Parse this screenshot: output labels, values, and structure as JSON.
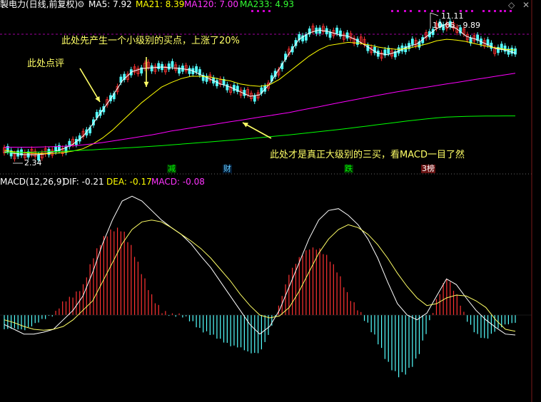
{
  "header": {
    "title": "製电力(日线,前复权)",
    "ma5_label": "MA5: 7.92",
    "ma21_label": "MA21: 8.39",
    "ma120_label": "MA120: 7.00",
    "ma233_label": "MA233: 4.93",
    "settings_icon": "gear-icon",
    "right_icons": [
      "diamond-icon",
      "close-icon"
    ]
  },
  "colors": {
    "up": "#ff3232",
    "down": "#54ffff",
    "ma5": "#ffffff",
    "ma21": "#ffff00",
    "ma120": "#ff00ff",
    "ma233": "#00ff00",
    "annotation": "#ffff66",
    "grid_dash": "#a000a0"
  },
  "annotations": {
    "a1": "此处先产生一个小级别的买点，上涨了20%",
    "a2": "此处点评",
    "a3": "此处才是真正大级别的三买，看MACD一目了然"
  },
  "price_labels": {
    "high": "11.11",
    "range": "10.05 - 9.89",
    "low": "2.34"
  },
  "events": [
    "减",
    "财",
    "跌",
    "3榜"
  ],
  "macd": {
    "title": "MACD(12,26,9)",
    "dif_label": "DIF: -0.21",
    "dea_label": "DEA: -0.17",
    "macd_label": "MACD: -0.08"
  },
  "chart_data": [
    {
      "type": "line",
      "title": "製电力(日线,前复权)",
      "series": [
        {
          "name": "MA5",
          "values": [
            2.6,
            2.5,
            2.42,
            2.4,
            2.45,
            2.6,
            2.8,
            3.1,
            3.6,
            4.4,
            5.3,
            6.2,
            7.2,
            7.8,
            8.0,
            8.05,
            8.1,
            8.05,
            8.0,
            7.9,
            7.6,
            7.3,
            7.0,
            6.8,
            6.5,
            6.2,
            6.3,
            7.0,
            8.0,
            9.0,
            9.9,
            10.3,
            10.5,
            10.4,
            10.2,
            10.1,
            9.8,
            9.4,
            9.0,
            8.9,
            9.1,
            9.4,
            9.6,
            10.1,
            10.6,
            10.9,
            10.6,
            10.1,
            9.9,
            9.6,
            9.3,
            9.2,
            9.0
          ]
        },
        {
          "name": "MA21",
          "values": [
            2.7,
            2.6,
            2.55,
            2.5,
            2.48,
            2.5,
            2.55,
            2.65,
            2.8,
            3.1,
            3.5,
            4.0,
            4.6,
            5.2,
            5.8,
            6.3,
            6.8,
            7.1,
            7.35,
            7.5,
            7.5,
            7.45,
            7.3,
            7.2,
            7.0,
            6.9,
            6.85,
            6.95,
            7.3,
            7.8,
            8.3,
            8.8,
            9.2,
            9.5,
            9.6,
            9.7,
            9.65,
            9.55,
            9.4,
            9.3,
            9.25,
            9.3,
            9.45,
            9.6,
            9.8,
            9.9,
            9.85,
            9.75,
            9.6,
            9.45,
            9.35,
            9.25,
            9.2
          ]
        },
        {
          "name": "MA120",
          "values": [
            2.9,
            2.9,
            2.9,
            2.9,
            2.92,
            2.94,
            2.96,
            3.0,
            3.05,
            3.12,
            3.2,
            3.3,
            3.4,
            3.5,
            3.6,
            3.7,
            3.82,
            3.95,
            4.05,
            4.15,
            4.25,
            4.35,
            4.45,
            4.55,
            4.65,
            4.75,
            4.85,
            4.95,
            5.05,
            5.15,
            5.28,
            5.4,
            5.52,
            5.65,
            5.78,
            5.9,
            6.02,
            6.14,
            6.26,
            6.38,
            6.5,
            6.6,
            6.7,
            6.8,
            6.9,
            7.0,
            7.1,
            7.2,
            7.3,
            7.4,
            7.5,
            7.6,
            7.7
          ]
        },
        {
          "name": "MA233",
          "values": [
            2.55,
            2.56,
            2.57,
            2.58,
            2.6,
            2.62,
            2.64,
            2.67,
            2.7,
            2.73,
            2.77,
            2.8,
            2.84,
            2.88,
            2.92,
            2.96,
            3.0,
            3.05,
            3.1,
            3.15,
            3.2,
            3.25,
            3.3,
            3.35,
            3.4,
            3.46,
            3.52,
            3.58,
            3.64,
            3.7,
            3.77,
            3.84,
            3.91,
            3.98,
            4.05,
            4.12,
            4.2,
            4.28,
            4.36,
            4.44,
            4.52,
            4.6,
            4.67,
            4.74,
            4.8,
            4.85,
            4.88,
            4.9,
            4.91,
            4.92,
            4.925,
            4.93,
            4.93
          ]
        }
      ],
      "ylim": [
        2.0,
        11.8
      ]
    },
    {
      "type": "line",
      "title": "MACD(12,26,9)",
      "series": [
        {
          "name": "DIF",
          "values": [
            -0.1,
            -0.15,
            -0.2,
            -0.2,
            -0.18,
            -0.15,
            -0.05,
            0.05,
            0.2,
            0.45,
            0.75,
            1.0,
            1.2,
            1.25,
            1.2,
            1.1,
            1.0,
            0.92,
            0.85,
            0.75,
            0.62,
            0.5,
            0.35,
            0.2,
            0.05,
            -0.1,
            -0.2,
            -0.12,
            0.05,
            0.3,
            0.55,
            0.8,
            1.0,
            1.1,
            1.12,
            1.05,
            0.95,
            0.8,
            0.6,
            0.35,
            0.12,
            0.0,
            -0.05,
            0.02,
            0.2,
            0.38,
            0.32,
            0.18,
            0.05,
            -0.05,
            -0.13,
            -0.2,
            -0.21
          ]
        },
        {
          "name": "DEA",
          "values": [
            -0.05,
            -0.08,
            -0.12,
            -0.15,
            -0.16,
            -0.15,
            -0.12,
            -0.05,
            0.05,
            0.15,
            0.35,
            0.55,
            0.75,
            0.9,
            0.98,
            1.0,
            0.98,
            0.92,
            0.85,
            0.78,
            0.7,
            0.6,
            0.48,
            0.36,
            0.22,
            0.1,
            0.0,
            -0.03,
            -0.01,
            0.08,
            0.25,
            0.45,
            0.65,
            0.8,
            0.9,
            0.95,
            0.92,
            0.85,
            0.74,
            0.6,
            0.44,
            0.3,
            0.18,
            0.1,
            0.12,
            0.18,
            0.21,
            0.2,
            0.15,
            0.08,
            -0.05,
            -0.15,
            -0.17
          ]
        },
        {
          "name": "MACD",
          "values": [
            -0.15,
            -0.14,
            -0.16,
            -0.1,
            -0.04,
            0.0,
            0.14,
            0.2,
            0.3,
            0.6,
            0.8,
            0.9,
            0.9,
            0.7,
            0.44,
            0.2,
            0.04,
            0.0,
            0.0,
            -0.06,
            -0.16,
            -0.2,
            -0.26,
            -0.32,
            -0.34,
            -0.4,
            -0.4,
            -0.18,
            0.12,
            0.44,
            0.6,
            0.7,
            0.7,
            0.6,
            0.44,
            0.2,
            0.06,
            -0.1,
            -0.28,
            -0.5,
            -0.64,
            -0.6,
            -0.46,
            -0.16,
            0.16,
            0.4,
            0.22,
            -0.04,
            -0.2,
            -0.26,
            -0.16,
            -0.1,
            -0.08
          ]
        }
      ],
      "ylim": [
        -0.9,
        1.35
      ]
    }
  ]
}
